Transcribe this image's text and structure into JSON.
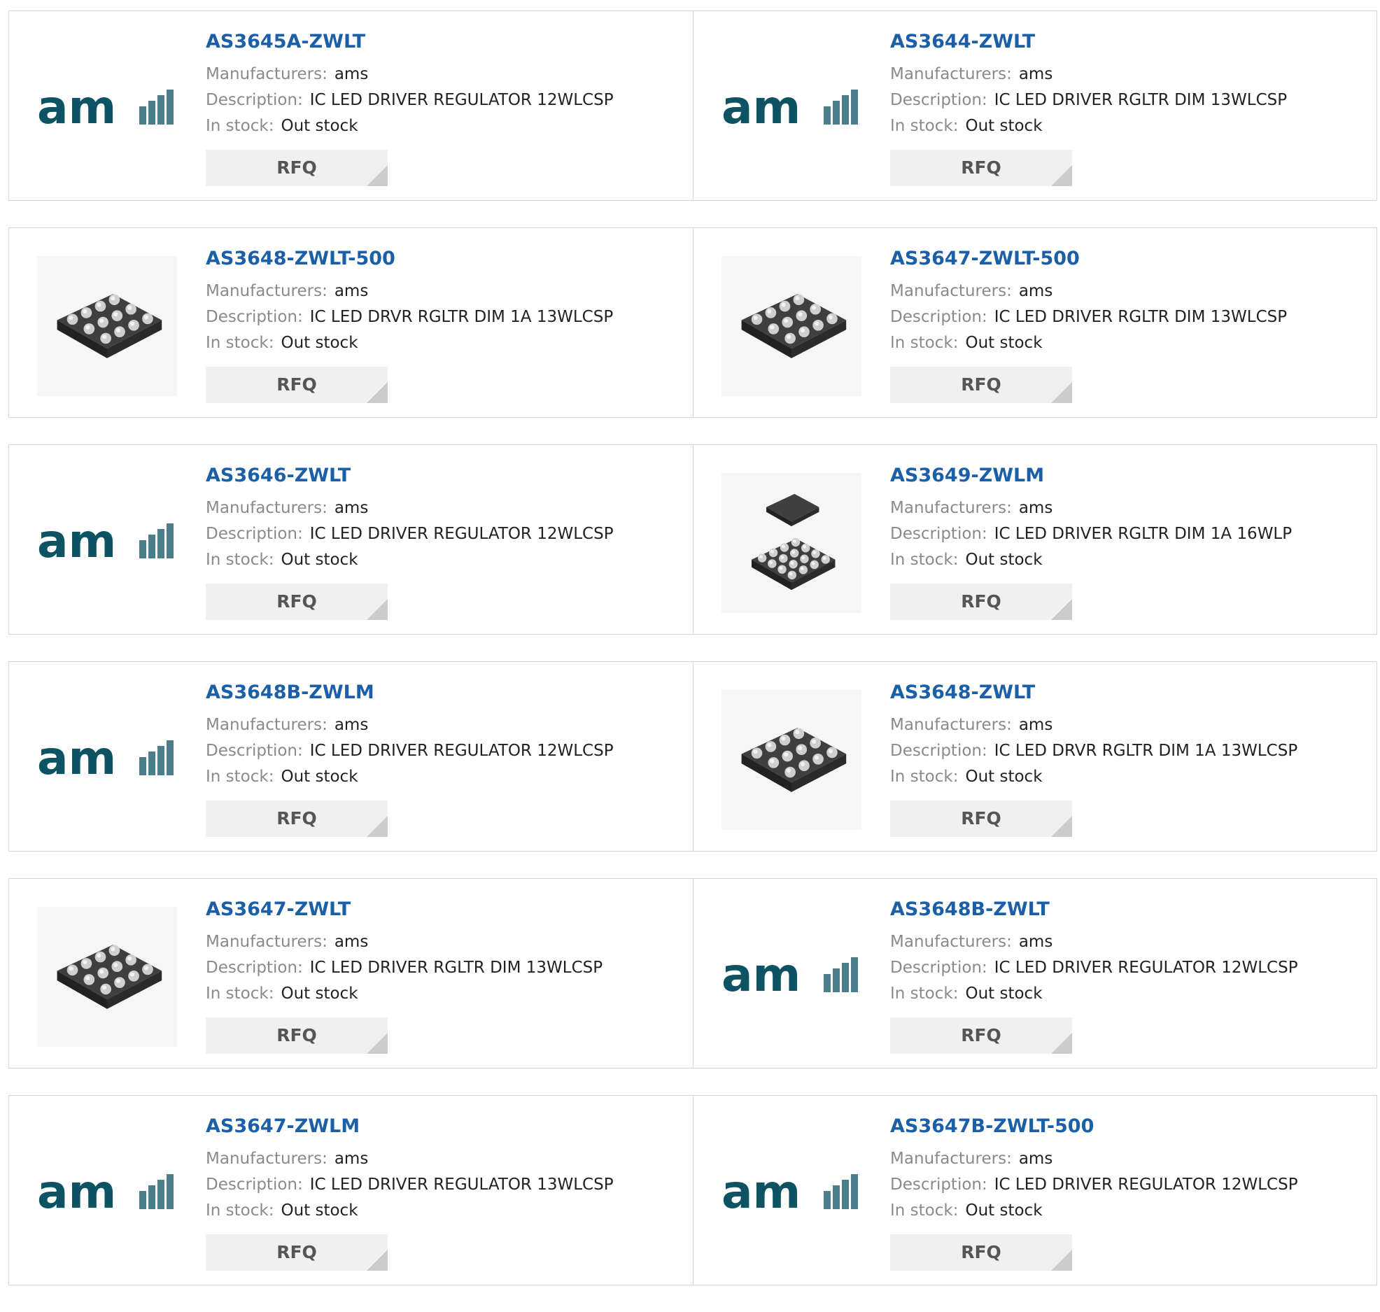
{
  "labels": {
    "manufacturers": "Manufacturers:",
    "description": "Description:",
    "in_stock": "In stock:",
    "rfq": "RFQ"
  },
  "brand": {
    "logo_text": "am",
    "logo_color": "#0e5363"
  },
  "products": [
    {
      "part": "AS3645A-ZWLT",
      "manufacturer": "ams",
      "description": "IC LED DRIVER REGULATOR 12WLCSP",
      "stock": "Out stock",
      "image": "ams-logo"
    },
    {
      "part": "AS3644-ZWLT",
      "manufacturer": "ams",
      "description": "IC LED DRIVER RGLTR DIM 13WLCSP",
      "stock": "Out stock",
      "image": "ams-logo"
    },
    {
      "part": "AS3648-ZWLT-500",
      "manufacturer": "ams",
      "description": "IC LED DRVR RGLTR DIM 1A 13WLCSP",
      "stock": "Out stock",
      "image": "chip-wlcsp"
    },
    {
      "part": "AS3647-ZWLT-500",
      "manufacturer": "ams",
      "description": "IC LED DRIVER RGLTR DIM 13WLCSP",
      "stock": "Out stock",
      "image": "chip-wlcsp"
    },
    {
      "part": "AS3646-ZWLT",
      "manufacturer": "ams",
      "description": "IC LED DRIVER REGULATOR 12WLCSP",
      "stock": "Out stock",
      "image": "ams-logo"
    },
    {
      "part": "AS3649-ZWLM",
      "manufacturer": "ams",
      "description": "IC LED DRIVER RGLTR DIM 1A 16WLP",
      "stock": "Out stock",
      "image": "chip-wlp-pair"
    },
    {
      "part": "AS3648B-ZWLM",
      "manufacturer": "ams",
      "description": "IC LED DRIVER REGULATOR 12WLCSP",
      "stock": "Out stock",
      "image": "ams-logo"
    },
    {
      "part": "AS3648-ZWLT",
      "manufacturer": "ams",
      "description": "IC LED DRVR RGLTR DIM 1A 13WLCSP",
      "stock": "Out stock",
      "image": "chip-wlcsp"
    },
    {
      "part": "AS3647-ZWLT",
      "manufacturer": "ams",
      "description": "IC LED DRIVER RGLTR DIM 13WLCSP",
      "stock": "Out stock",
      "image": "chip-wlcsp"
    },
    {
      "part": "AS3648B-ZWLT",
      "manufacturer": "ams",
      "description": "IC LED DRIVER REGULATOR 12WLCSP",
      "stock": "Out stock",
      "image": "ams-logo"
    },
    {
      "part": "AS3647-ZWLM",
      "manufacturer": "ams",
      "description": "IC LED DRIVER REGULATOR 13WLCSP",
      "stock": "Out stock",
      "image": "ams-logo"
    },
    {
      "part": "AS3647B-ZWLT-500",
      "manufacturer": "ams",
      "description": "IC LED DRIVER REGULATOR 12WLCSP",
      "stock": "Out stock",
      "image": "ams-logo"
    }
  ]
}
